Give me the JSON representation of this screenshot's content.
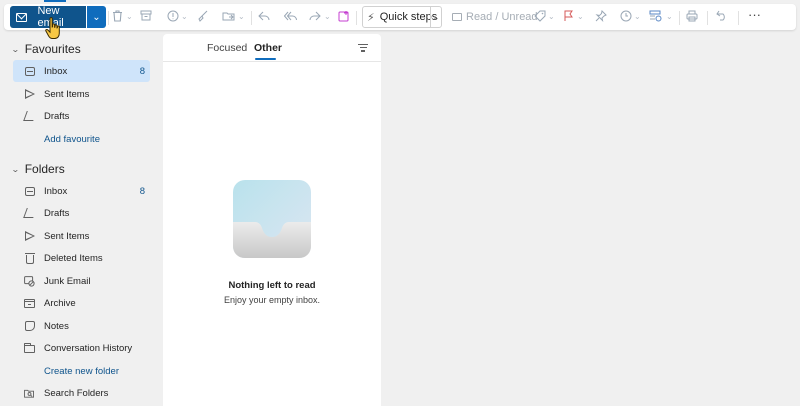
{
  "toolbar": {
    "new_email_label": "New email",
    "quick_steps_label": "Quick steps",
    "read_unread_label": "Read / Unread",
    "more_label": "···"
  },
  "sidebar": {
    "favourites": {
      "header": "Favourites",
      "items": [
        {
          "label": "Inbox",
          "count": "8",
          "icon": "inbox-icon"
        },
        {
          "label": "Sent Items",
          "icon": "send-icon"
        },
        {
          "label": "Drafts",
          "icon": "drafts-icon"
        }
      ],
      "add_link": "Add favourite"
    },
    "folders": {
      "header": "Folders",
      "items": [
        {
          "label": "Inbox",
          "count": "8",
          "icon": "inbox-icon"
        },
        {
          "label": "Drafts",
          "icon": "drafts-icon"
        },
        {
          "label": "Sent Items",
          "icon": "send-icon"
        },
        {
          "label": "Deleted Items",
          "icon": "trash-icon"
        },
        {
          "label": "Junk Email",
          "icon": "junk-icon"
        },
        {
          "label": "Archive",
          "icon": "archive-icon"
        },
        {
          "label": "Notes",
          "icon": "note-icon"
        },
        {
          "label": "Conversation History",
          "icon": "folder-icon"
        }
      ],
      "create_link": "Create new folder",
      "search_folders": {
        "label": "Search Folders",
        "icon": "search-folder-icon"
      }
    }
  },
  "message_list": {
    "tabs": [
      {
        "label": "Focused"
      },
      {
        "label": "Other"
      }
    ],
    "active_tab": "Other",
    "empty_title": "Nothing left to read",
    "empty_subtitle": "Enjoy your empty inbox."
  },
  "colors": {
    "accent": "#0f6cbd",
    "accent_dark": "#0f548c",
    "selected_bg": "#cfe4fa",
    "app_bg": "#f0f0f0"
  }
}
